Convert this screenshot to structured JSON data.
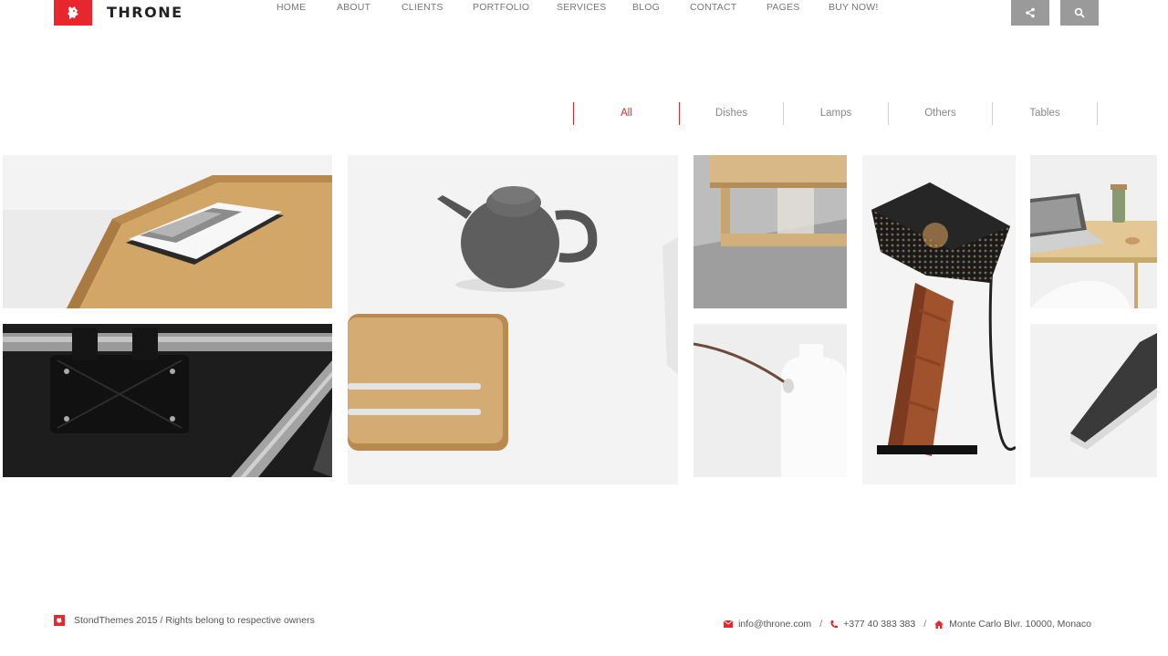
{
  "brand": {
    "name": "THRONE",
    "accent": "#e8262d"
  },
  "nav": [
    {
      "label": "HOME"
    },
    {
      "label": "ABOUT"
    },
    {
      "label": "CLIENTS"
    },
    {
      "label": "PORTFOLIO"
    },
    {
      "label": "SERVICES"
    },
    {
      "label": "BLOG"
    },
    {
      "label": "CONTACT"
    },
    {
      "label": "PAGES"
    },
    {
      "label": "BUY NOW!"
    }
  ],
  "header_buttons": [
    {
      "icon": "share-icon"
    },
    {
      "icon": "search-icon"
    }
  ],
  "filters": [
    {
      "label": "All",
      "active": true
    },
    {
      "label": "Dishes",
      "active": false
    },
    {
      "label": "Lamps",
      "active": false
    },
    {
      "label": "Others",
      "active": false
    },
    {
      "label": "Tables",
      "active": false
    }
  ],
  "portfolio": [
    {
      "subject": "wooden-desk-with-magazine"
    },
    {
      "subject": "leather-bike-frame-bag"
    },
    {
      "subject": "teapot-and-wooden-tray"
    },
    {
      "subject": "wooden-shelf-table"
    },
    {
      "subject": "white-bottle-lamp"
    },
    {
      "subject": "perforated-wooden-lamp"
    },
    {
      "subject": "laptop-on-desk"
    },
    {
      "subject": "tablet-closeup"
    }
  ],
  "footer": {
    "copyright": "StondThemes 2015 / Rights  belong to respective owners",
    "email": "info@throne.com",
    "phone": "+377 40 383 383",
    "address": "Monte Carlo Blvr. 10000, Monaco",
    "separator": "/"
  }
}
